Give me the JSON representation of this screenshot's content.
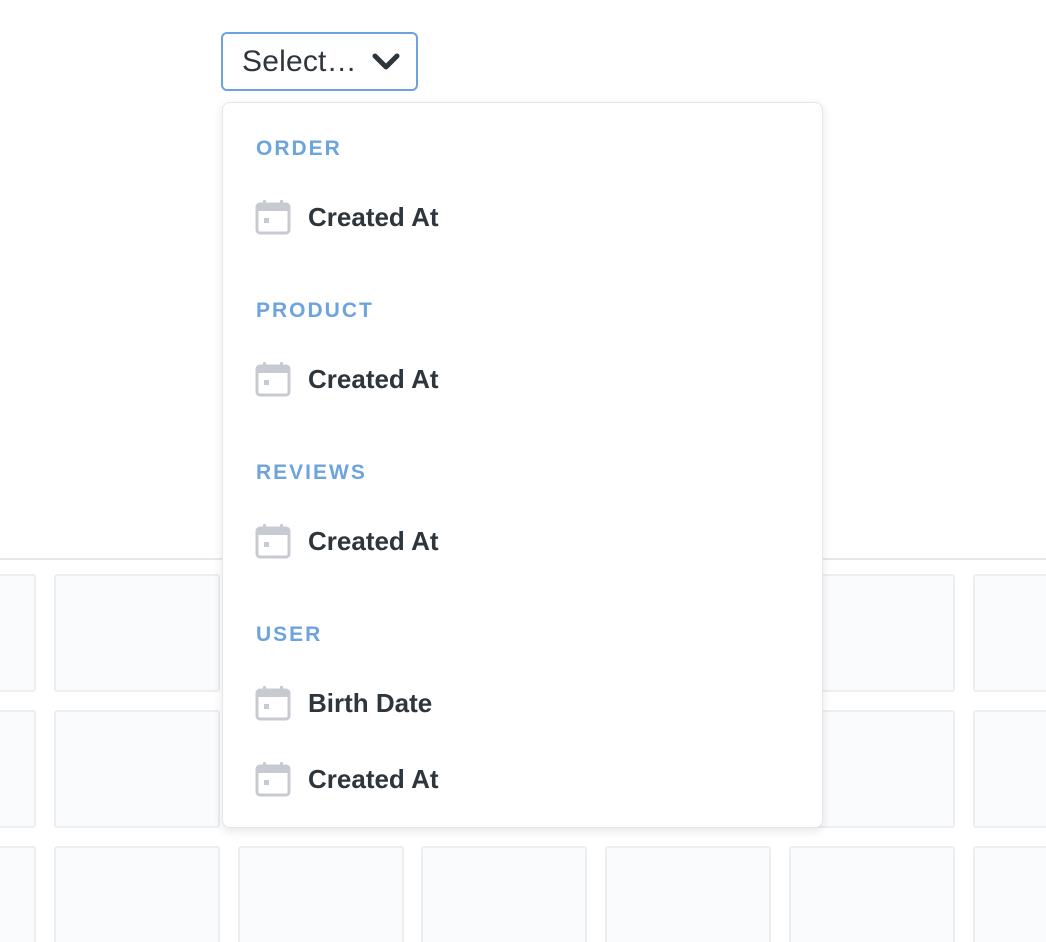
{
  "select": {
    "label": "Select…"
  },
  "dropdown": {
    "sections": [
      {
        "title": "ORDER",
        "options": [
          "Created At"
        ]
      },
      {
        "title": "PRODUCT",
        "options": [
          "Created At"
        ]
      },
      {
        "title": "REVIEWS",
        "options": [
          "Created At"
        ]
      },
      {
        "title": "USER",
        "options": [
          "Birth Date",
          "Created At"
        ]
      }
    ]
  },
  "icons": {
    "trigger": "chevron-down-icon",
    "option": "calendar-icon"
  },
  "colors": {
    "accent": "#6ea2dd",
    "section_header": "#6da4dd",
    "text": "#2e353b",
    "icon": "#c7cbd1"
  }
}
